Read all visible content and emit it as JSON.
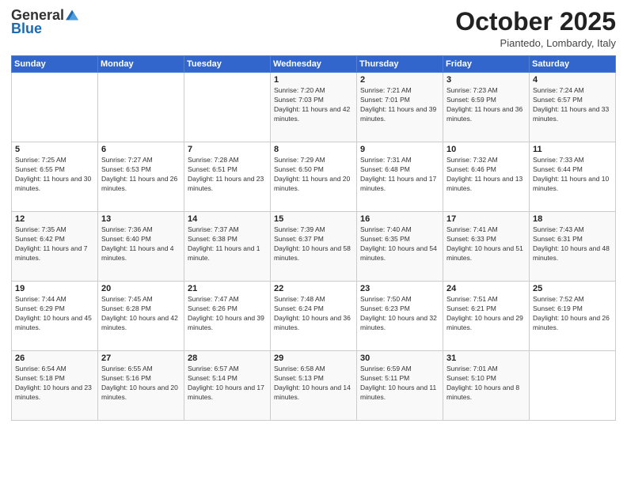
{
  "logo": {
    "general": "General",
    "blue": "Blue"
  },
  "header": {
    "month": "October 2025",
    "location": "Piantedo, Lombardy, Italy"
  },
  "weekdays": [
    "Sunday",
    "Monday",
    "Tuesday",
    "Wednesday",
    "Thursday",
    "Friday",
    "Saturday"
  ],
  "weeks": [
    [
      {
        "day": "",
        "sunrise": "",
        "sunset": "",
        "daylight": ""
      },
      {
        "day": "",
        "sunrise": "",
        "sunset": "",
        "daylight": ""
      },
      {
        "day": "",
        "sunrise": "",
        "sunset": "",
        "daylight": ""
      },
      {
        "day": "1",
        "sunrise": "Sunrise: 7:20 AM",
        "sunset": "Sunset: 7:03 PM",
        "daylight": "Daylight: 11 hours and 42 minutes."
      },
      {
        "day": "2",
        "sunrise": "Sunrise: 7:21 AM",
        "sunset": "Sunset: 7:01 PM",
        "daylight": "Daylight: 11 hours and 39 minutes."
      },
      {
        "day": "3",
        "sunrise": "Sunrise: 7:23 AM",
        "sunset": "Sunset: 6:59 PM",
        "daylight": "Daylight: 11 hours and 36 minutes."
      },
      {
        "day": "4",
        "sunrise": "Sunrise: 7:24 AM",
        "sunset": "Sunset: 6:57 PM",
        "daylight": "Daylight: 11 hours and 33 minutes."
      }
    ],
    [
      {
        "day": "5",
        "sunrise": "Sunrise: 7:25 AM",
        "sunset": "Sunset: 6:55 PM",
        "daylight": "Daylight: 11 hours and 30 minutes."
      },
      {
        "day": "6",
        "sunrise": "Sunrise: 7:27 AM",
        "sunset": "Sunset: 6:53 PM",
        "daylight": "Daylight: 11 hours and 26 minutes."
      },
      {
        "day": "7",
        "sunrise": "Sunrise: 7:28 AM",
        "sunset": "Sunset: 6:51 PM",
        "daylight": "Daylight: 11 hours and 23 minutes."
      },
      {
        "day": "8",
        "sunrise": "Sunrise: 7:29 AM",
        "sunset": "Sunset: 6:50 PM",
        "daylight": "Daylight: 11 hours and 20 minutes."
      },
      {
        "day": "9",
        "sunrise": "Sunrise: 7:31 AM",
        "sunset": "Sunset: 6:48 PM",
        "daylight": "Daylight: 11 hours and 17 minutes."
      },
      {
        "day": "10",
        "sunrise": "Sunrise: 7:32 AM",
        "sunset": "Sunset: 6:46 PM",
        "daylight": "Daylight: 11 hours and 13 minutes."
      },
      {
        "day": "11",
        "sunrise": "Sunrise: 7:33 AM",
        "sunset": "Sunset: 6:44 PM",
        "daylight": "Daylight: 11 hours and 10 minutes."
      }
    ],
    [
      {
        "day": "12",
        "sunrise": "Sunrise: 7:35 AM",
        "sunset": "Sunset: 6:42 PM",
        "daylight": "Daylight: 11 hours and 7 minutes."
      },
      {
        "day": "13",
        "sunrise": "Sunrise: 7:36 AM",
        "sunset": "Sunset: 6:40 PM",
        "daylight": "Daylight: 11 hours and 4 minutes."
      },
      {
        "day": "14",
        "sunrise": "Sunrise: 7:37 AM",
        "sunset": "Sunset: 6:38 PM",
        "daylight": "Daylight: 11 hours and 1 minute."
      },
      {
        "day": "15",
        "sunrise": "Sunrise: 7:39 AM",
        "sunset": "Sunset: 6:37 PM",
        "daylight": "Daylight: 10 hours and 58 minutes."
      },
      {
        "day": "16",
        "sunrise": "Sunrise: 7:40 AM",
        "sunset": "Sunset: 6:35 PM",
        "daylight": "Daylight: 10 hours and 54 minutes."
      },
      {
        "day": "17",
        "sunrise": "Sunrise: 7:41 AM",
        "sunset": "Sunset: 6:33 PM",
        "daylight": "Daylight: 10 hours and 51 minutes."
      },
      {
        "day": "18",
        "sunrise": "Sunrise: 7:43 AM",
        "sunset": "Sunset: 6:31 PM",
        "daylight": "Daylight: 10 hours and 48 minutes."
      }
    ],
    [
      {
        "day": "19",
        "sunrise": "Sunrise: 7:44 AM",
        "sunset": "Sunset: 6:29 PM",
        "daylight": "Daylight: 10 hours and 45 minutes."
      },
      {
        "day": "20",
        "sunrise": "Sunrise: 7:45 AM",
        "sunset": "Sunset: 6:28 PM",
        "daylight": "Daylight: 10 hours and 42 minutes."
      },
      {
        "day": "21",
        "sunrise": "Sunrise: 7:47 AM",
        "sunset": "Sunset: 6:26 PM",
        "daylight": "Daylight: 10 hours and 39 minutes."
      },
      {
        "day": "22",
        "sunrise": "Sunrise: 7:48 AM",
        "sunset": "Sunset: 6:24 PM",
        "daylight": "Daylight: 10 hours and 36 minutes."
      },
      {
        "day": "23",
        "sunrise": "Sunrise: 7:50 AM",
        "sunset": "Sunset: 6:23 PM",
        "daylight": "Daylight: 10 hours and 32 minutes."
      },
      {
        "day": "24",
        "sunrise": "Sunrise: 7:51 AM",
        "sunset": "Sunset: 6:21 PM",
        "daylight": "Daylight: 10 hours and 29 minutes."
      },
      {
        "day": "25",
        "sunrise": "Sunrise: 7:52 AM",
        "sunset": "Sunset: 6:19 PM",
        "daylight": "Daylight: 10 hours and 26 minutes."
      }
    ],
    [
      {
        "day": "26",
        "sunrise": "Sunrise: 6:54 AM",
        "sunset": "Sunset: 5:18 PM",
        "daylight": "Daylight: 10 hours and 23 minutes."
      },
      {
        "day": "27",
        "sunrise": "Sunrise: 6:55 AM",
        "sunset": "Sunset: 5:16 PM",
        "daylight": "Daylight: 10 hours and 20 minutes."
      },
      {
        "day": "28",
        "sunrise": "Sunrise: 6:57 AM",
        "sunset": "Sunset: 5:14 PM",
        "daylight": "Daylight: 10 hours and 17 minutes."
      },
      {
        "day": "29",
        "sunrise": "Sunrise: 6:58 AM",
        "sunset": "Sunset: 5:13 PM",
        "daylight": "Daylight: 10 hours and 14 minutes."
      },
      {
        "day": "30",
        "sunrise": "Sunrise: 6:59 AM",
        "sunset": "Sunset: 5:11 PM",
        "daylight": "Daylight: 10 hours and 11 minutes."
      },
      {
        "day": "31",
        "sunrise": "Sunrise: 7:01 AM",
        "sunset": "Sunset: 5:10 PM",
        "daylight": "Daylight: 10 hours and 8 minutes."
      },
      {
        "day": "",
        "sunrise": "",
        "sunset": "",
        "daylight": ""
      }
    ]
  ]
}
